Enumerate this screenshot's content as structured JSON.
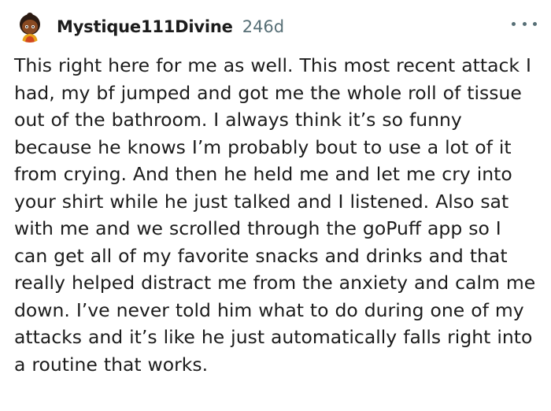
{
  "comment": {
    "author": "Mystique111Divine",
    "age": "246d",
    "more_icon": "more-horizontal-icon",
    "avatar_icon": "snoo-avatar-icon",
    "body": "This right here for me as well. This most recent attack I had, my bf jumped and got me the whole roll of tissue out of the bathroom. I always think it’s so funny because he knows I’m probably bout to use a lot of it from crying. And then he held me and let me cry into your shirt while he just talked and I listened. Also sat with me and we scrolled through the goPuff app so I can get all of my favorite snacks and drinks and that really helped distract me from the anxiety and calm me down. I’ve never told him what to do during one of my attacks and it’s like he just automatically falls right into a routine that works."
  }
}
